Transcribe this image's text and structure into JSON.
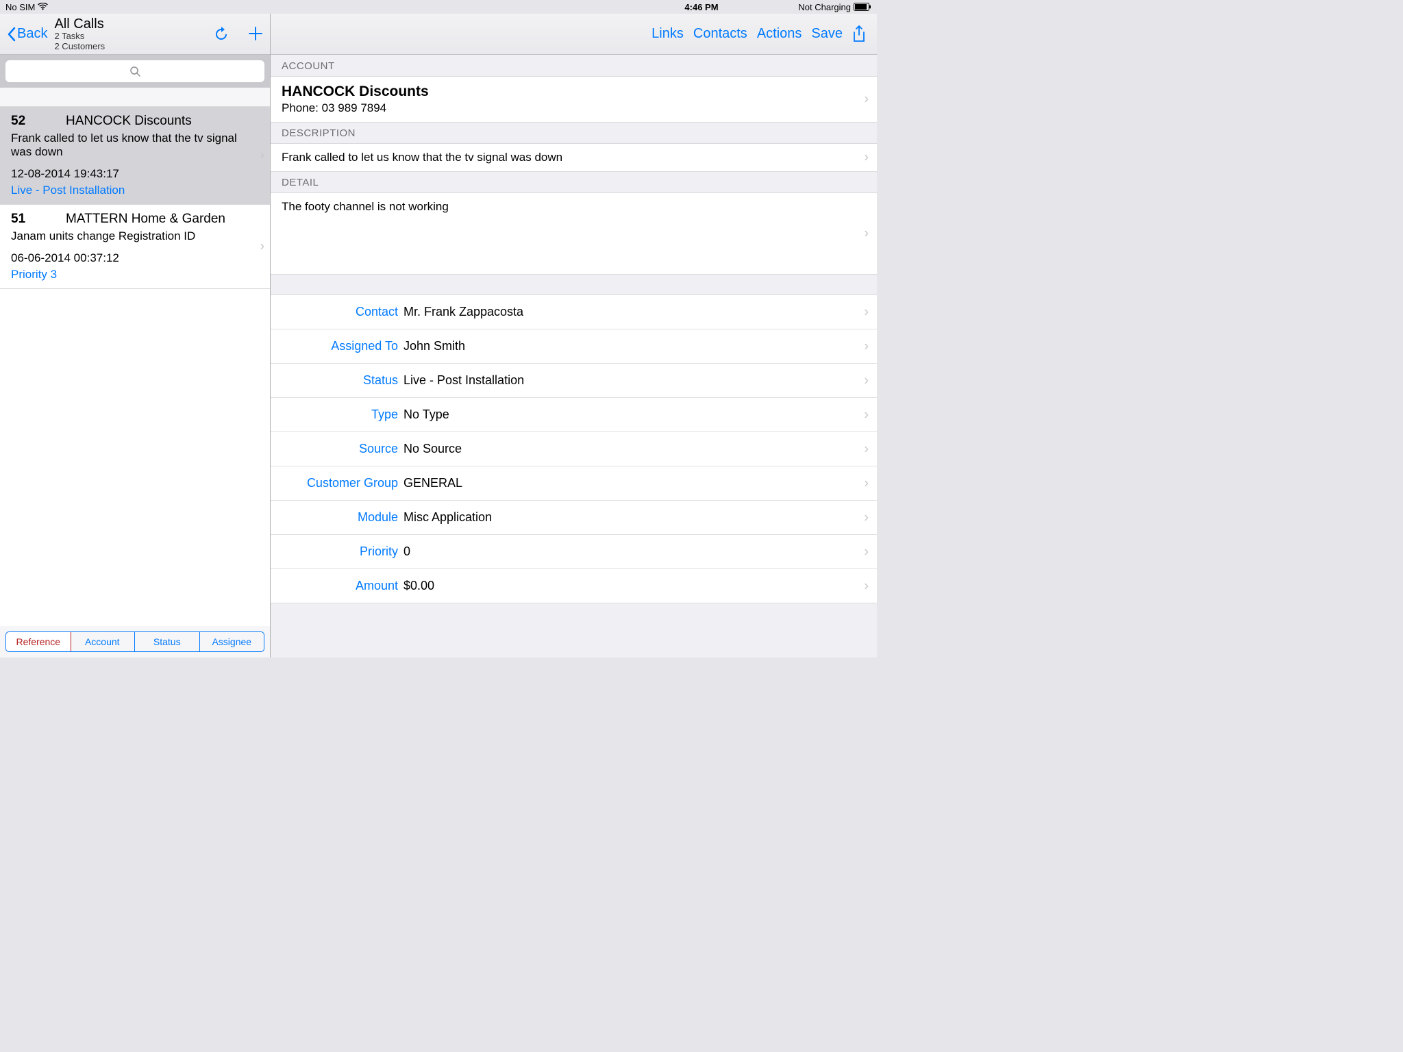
{
  "status_bar": {
    "carrier": "No SIM",
    "time": "4:46 PM",
    "charging": "Not Charging"
  },
  "left": {
    "back": "Back",
    "title": "All Calls",
    "sub1": "2 Tasks",
    "sub2": "2 Customers"
  },
  "calls": [
    {
      "id": "52",
      "account": "HANCOCK Discounts",
      "desc": "Frank called to let us know that the tv signal was down",
      "date": "12-08-2014 19:43:17",
      "status": "Live - Post Installation",
      "selected": true
    },
    {
      "id": "51",
      "account": "MATTERN Home & Garden",
      "desc": "Janam units change Registration ID",
      "date": "06-06-2014 00:37:12",
      "status": "Priority 3",
      "selected": false
    }
  ],
  "segments": [
    "Reference",
    "Account",
    "Status",
    "Assignee"
  ],
  "right_nav": [
    "Links",
    "Contacts",
    "Actions",
    "Save"
  ],
  "detail": {
    "account_header": "ACCOUNT",
    "account_name": "HANCOCK Discounts",
    "account_phone": "Phone: 03 989 7894",
    "description_header": "DESCRIPTION",
    "description_text": "Frank called to let us know that the tv signal was down",
    "detail_header": "DETAIL",
    "detail_text": "The footy channel is not working",
    "fields": [
      {
        "label": "Contact",
        "value": "Mr. Frank Zappacosta"
      },
      {
        "label": "Assigned To",
        "value": "John Smith"
      },
      {
        "label": "Status",
        "value": "Live - Post Installation"
      },
      {
        "label": "Type",
        "value": "No Type"
      },
      {
        "label": "Source",
        "value": "No Source"
      },
      {
        "label": "Customer Group",
        "value": "GENERAL"
      },
      {
        "label": "Module",
        "value": "Misc Application"
      },
      {
        "label": "Priority",
        "value": "0"
      },
      {
        "label": "Amount",
        "value": "$0.00"
      }
    ]
  }
}
